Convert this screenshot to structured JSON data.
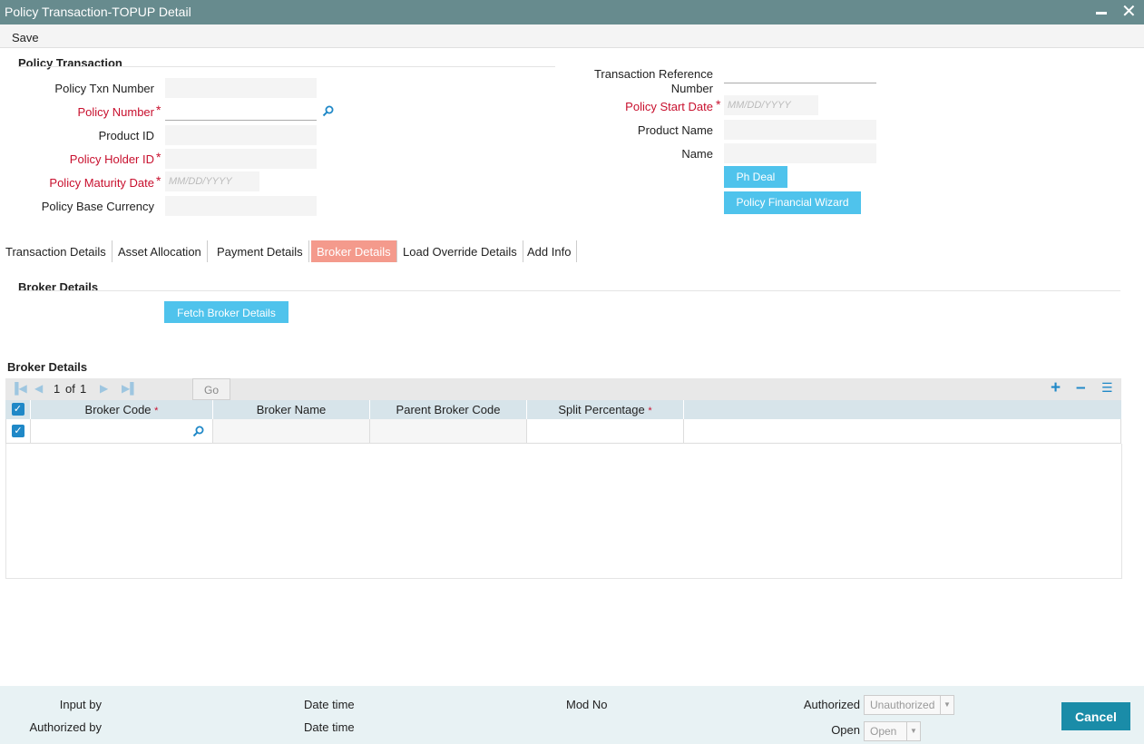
{
  "window": {
    "title": "Policy Transaction-TOPUP Detail",
    "minimize": "minimize",
    "close": "✕"
  },
  "toolbar": {
    "save_label": "Save"
  },
  "policy_section": {
    "title": "Policy Transaction",
    "txn_number_label": "Policy Txn Number",
    "policy_number_label": "Policy Number",
    "product_id_label": "Product ID",
    "holder_id_label": "Policy Holder ID",
    "maturity_date_label": "Policy Maturity Date",
    "maturity_date_placeholder": "MM/DD/YYYY",
    "base_currency_label": "Policy Base Currency",
    "txn_ref_label_1": "Transaction Reference",
    "txn_ref_label_2": "Number",
    "start_date_label": "Policy Start Date",
    "start_date_placeholder": "MM/DD/YYYY",
    "product_name_label": "Product Name",
    "name_label": "Name",
    "ph_deal_button": "Ph Deal",
    "wizard_button": "Policy Financial Wizard",
    "required_mark": "*"
  },
  "tabs": [
    {
      "label": "Transaction Details"
    },
    {
      "label": "Asset Allocation"
    },
    {
      "label": "Payment Details"
    },
    {
      "label": "Broker Details",
      "active": true
    },
    {
      "label": "Load Override Details"
    },
    {
      "label": "Add Info"
    }
  ],
  "broker_section": {
    "title": "Broker Details",
    "fetch_button": "Fetch Broker Details",
    "grid_title": "Broker Details"
  },
  "grid": {
    "pager": {
      "current": "1",
      "of_label": "of",
      "total": "1",
      "go_label": "Go"
    },
    "columns": [
      {
        "label": "Broker Code",
        "required": true
      },
      {
        "label": "Broker Name",
        "required": false
      },
      {
        "label": "Parent Broker Code",
        "required": false
      },
      {
        "label": "Split Percentage",
        "required": true
      }
    ],
    "required_mark": "*",
    "check_mark": "✓",
    "add_icon": "+",
    "remove_icon": "–",
    "list_icon": "☰"
  },
  "footer": {
    "input_by": "Input by",
    "authorized_by": "Authorized by",
    "date_time_1": "Date time",
    "date_time_2": "Date time",
    "mod_no": "Mod No",
    "authorized_label": "Authorized",
    "authorized_value": "Unauthorized",
    "open_label": "Open",
    "open_value": "Open",
    "cancel_label": "Cancel"
  },
  "colors": {
    "titlebar": "#678b8e",
    "accent_blue": "#4fc3ec",
    "active_tab": "#f49a8c",
    "cancel": "#1a8ca8",
    "required": "#c8102e"
  }
}
